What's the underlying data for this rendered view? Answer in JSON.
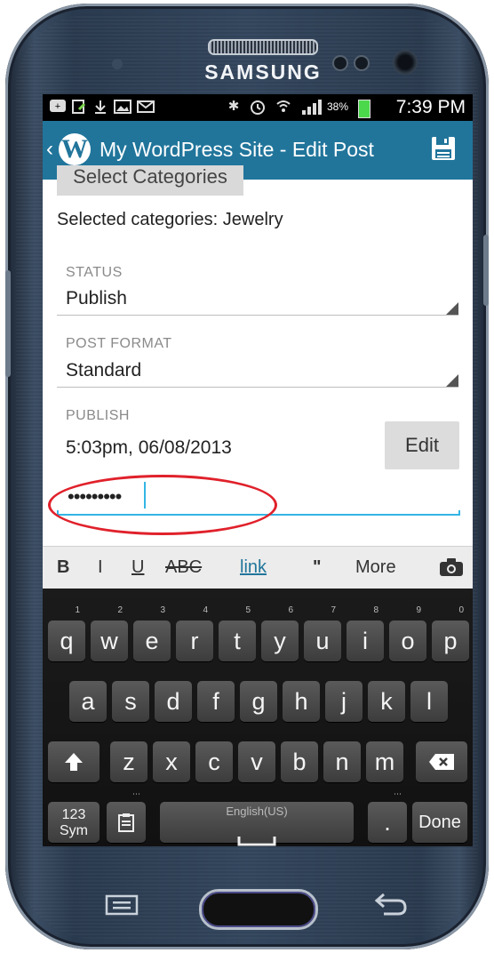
{
  "device": {
    "brand": "SAMSUNG"
  },
  "status_bar": {
    "battery_percent": "38%",
    "time": "7:39 PM",
    "icons": [
      "notification-icon",
      "upload-icon",
      "download-icon",
      "gallery-icon",
      "email-icon",
      "bluetooth-icon",
      "alarm-icon",
      "wifi-icon",
      "signal-icon",
      "battery-icon"
    ]
  },
  "action_bar": {
    "title": "My WordPress Site - Edit Post",
    "logo": "W",
    "save_icon": "save-icon",
    "color": "#21759b"
  },
  "form": {
    "select_categories_button": "Select Categories",
    "selected_categories": "Selected categories: Jewelry",
    "status": {
      "label": "STATUS",
      "value": "Publish"
    },
    "post_format": {
      "label": "POST FORMAT",
      "value": "Standard"
    },
    "publish": {
      "label": "PUBLISH",
      "value": "5:03pm, 06/08/2013",
      "edit_button": "Edit"
    },
    "password": {
      "value": "•••••••••"
    },
    "highlight_color": "#e0212b"
  },
  "format_toolbar": {
    "bold": "B",
    "italic": "I",
    "underline": "U",
    "strike": "ABC",
    "link": "link",
    "quote": "\"",
    "more": "More",
    "camera": "camera-icon"
  },
  "keyboard": {
    "row1": [
      {
        "key": "q",
        "num": "1"
      },
      {
        "key": "w",
        "num": "2"
      },
      {
        "key": "e",
        "num": "3"
      },
      {
        "key": "r",
        "num": "4"
      },
      {
        "key": "t",
        "num": "5"
      },
      {
        "key": "y",
        "num": "6"
      },
      {
        "key": "u",
        "num": "7"
      },
      {
        "key": "i",
        "num": "8"
      },
      {
        "key": "o",
        "num": "9"
      },
      {
        "key": "p",
        "num": "0"
      }
    ],
    "row2": [
      "a",
      "s",
      "d",
      "f",
      "g",
      "h",
      "j",
      "k",
      "l"
    ],
    "row3": [
      "z",
      "x",
      "c",
      "v",
      "b",
      "n",
      "m"
    ],
    "sym_key_line1": "123",
    "sym_key_line2": "Sym",
    "space_label": "English(US)",
    "period": ".",
    "done": "Done"
  }
}
